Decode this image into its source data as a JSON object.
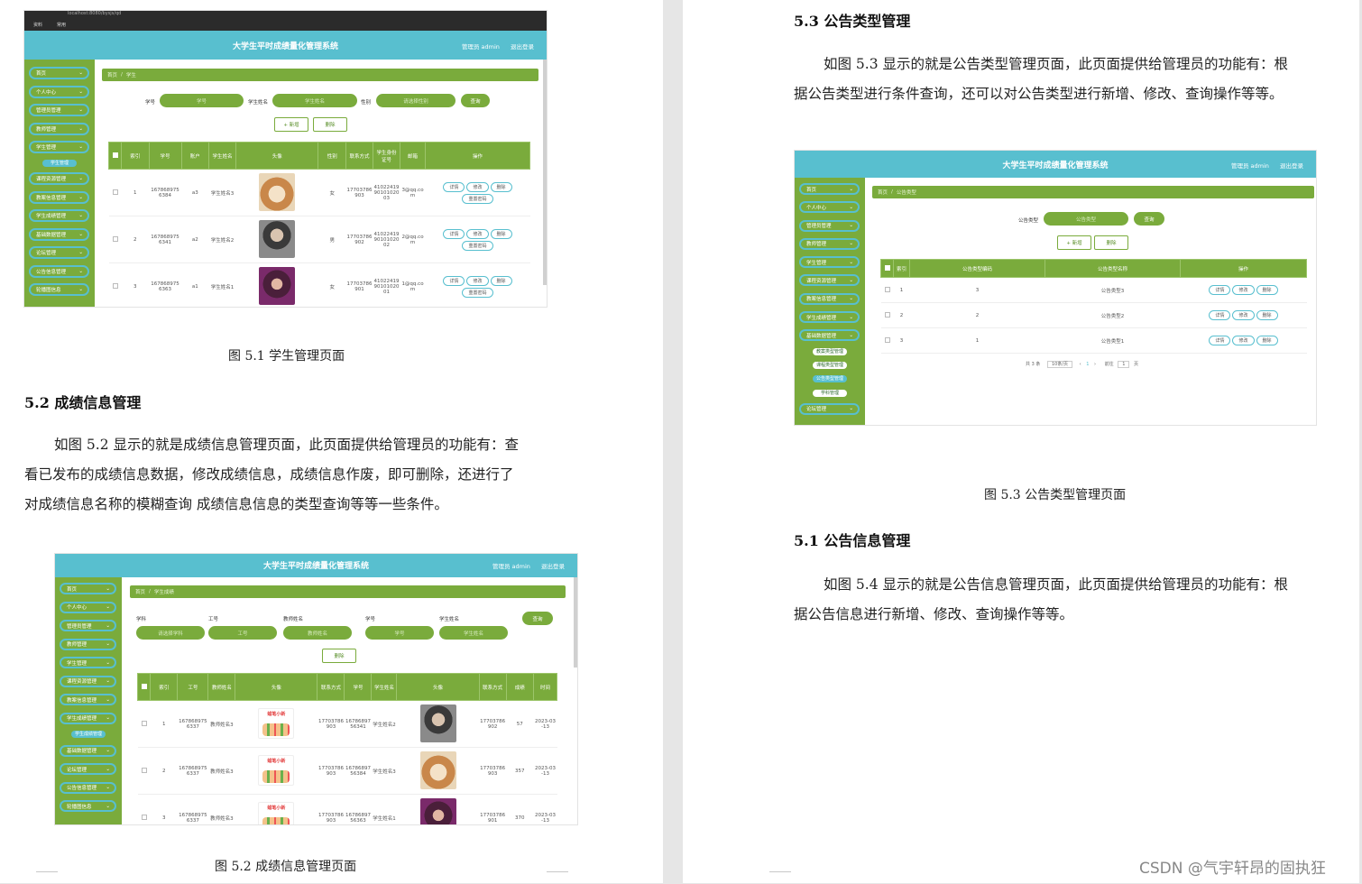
{
  "left_page": {
    "shot1": {
      "browser_text": "localhost:8080/bysjs/qd",
      "bookmarks": [
        "资料",
        "常用"
      ],
      "app_title": "大学生平时成绩量化管理系统",
      "user_text": "管理员 admin",
      "logout_text": "退出登录",
      "sidebar": [
        "首页",
        "个人中心",
        "管理员管理",
        "教师管理",
        "学生管理",
        "课程资源管理",
        "教案信息管理",
        "学生成绩管理",
        "基础数据管理",
        "论坛管理",
        "公告信息管理",
        "轮播图信息"
      ],
      "sidebar_sub": [
        "学生管理"
      ],
      "breadcrumb": [
        "首页",
        "学生"
      ],
      "filters": [
        {
          "label": "学号",
          "placeholder": "学号"
        },
        {
          "label": "学生姓名",
          "placeholder": "学生姓名"
        },
        {
          "label": "性别",
          "placeholder": "请选择性别"
        }
      ],
      "query_button": "查询",
      "add_button": "+ 新增",
      "delete_button": "删除",
      "columns": [
        "索引",
        "学号",
        "账户",
        "学生姓名",
        "头像",
        "性别",
        "联系方式",
        "学生身份证号",
        "邮箱",
        "操作"
      ],
      "rows": [
        {
          "index": "1",
          "id": "1678689756384",
          "account": "a3",
          "name": "学生姓名3",
          "gender": "女",
          "phone": "17703786903",
          "idcard": "410224199010102003",
          "email": "3@qq.com",
          "avatar": "dog"
        },
        {
          "index": "2",
          "id": "1678689756341",
          "account": "a2",
          "name": "学生姓名2",
          "gender": "男",
          "phone": "17703786902",
          "idcard": "410224199010102002",
          "email": "2@qq.com",
          "avatar": "man"
        },
        {
          "index": "3",
          "id": "1678689756363",
          "account": "a1",
          "name": "学生姓名1",
          "gender": "女",
          "phone": "17703786901",
          "idcard": "410224199010102001",
          "email": "1@qq.com",
          "avatar": "purple"
        }
      ],
      "row_actions": [
        "详情",
        "修改",
        "删除",
        "重置密码"
      ]
    },
    "caption1": "图 5.1  学生管理页面",
    "heading2": "5.2  成绩信息管理",
    "para2": [
      "如图 5.2 显示的就是成绩信息管理页面，此页面提供给管理员的功能有：查",
      "看已发布的成绩信息数据，修改成绩信息，成绩信息作废，即可删除，还进行了",
      "对成绩信息名称的模糊查询  成绩信息信息的类型查询等等一些条件。"
    ],
    "shot2": {
      "app_title": "大学生平时成绩量化管理系统",
      "user_text": "管理员 admin",
      "logout_text": "退出登录",
      "sidebar": [
        "首页",
        "个人中心",
        "管理员管理",
        "教师管理",
        "学生管理",
        "课程资源管理",
        "教案信息管理",
        "学生成绩管理",
        "基础数据管理",
        "论坛管理",
        "公告信息管理",
        "轮播图信息"
      ],
      "sidebar_sub": [
        "学生成绩管理"
      ],
      "breadcrumb": [
        "首页",
        "学生成绩"
      ],
      "filters": [
        {
          "label": "学科",
          "placeholder": "请选择学科"
        },
        {
          "label": "工号",
          "placeholder": "工号"
        },
        {
          "label": "教师姓名",
          "placeholder": "教师姓名"
        },
        {
          "label": "学号",
          "placeholder": "学号"
        },
        {
          "label": "学生姓名",
          "placeholder": "学生姓名"
        }
      ],
      "query_button": "查询",
      "delete_button": "删除",
      "columns": [
        "索引",
        "工号",
        "教师姓名",
        "头像",
        "联系方式",
        "学号",
        "学生姓名",
        "头像",
        "联系方式",
        "成绩",
        "时间"
      ],
      "rows": [
        {
          "index": "1",
          "job": "1678689756337",
          "teacher": "教师姓名3",
          "tphone": "17703786903",
          "sid": "1678689756341",
          "sname": "学生姓名2",
          "sphone": "17703786902",
          "score": "57",
          "time": "2023-03-13",
          "savatar": "man"
        },
        {
          "index": "2",
          "job": "1678689756337",
          "teacher": "教师姓名3",
          "tphone": "17703786903",
          "sid": "1678689756384",
          "sname": "学生姓名3",
          "sphone": "17703786903",
          "score": "357",
          "time": "2023-03-13",
          "savatar": "dog"
        },
        {
          "index": "3",
          "job": "1678689756337",
          "teacher": "教师姓名3",
          "tphone": "17703786903",
          "sid": "1678689756363",
          "sname": "学生姓名1",
          "sphone": "17703786901",
          "score": "370",
          "time": "2023-03-13",
          "savatar": "purple"
        }
      ],
      "cartoon_text": "蜡笔小新"
    },
    "caption2": "图 5.2  成绩信息管理页面"
  },
  "right_page": {
    "heading3": "5.3 公告类型管理",
    "para3": [
      "如图 5.3 显示的就是公告类型管理页面，此页面提供给管理员的功能有：根",
      "据公告类型进行条件查询，还可以对公告类型进行新增、修改、查询操作等等。"
    ],
    "shot3": {
      "app_title": "大学生平时成绩量化管理系统",
      "user_text": "管理员 admin",
      "logout_text": "退出登录",
      "sidebar": [
        "首页",
        "个人中心",
        "管理员管理",
        "教师管理",
        "学生管理",
        "课程资源管理",
        "教案信息管理",
        "学生成绩管理",
        "基础数据管理",
        "论坛管理"
      ],
      "sidebar_sub": [
        "教案类型管理",
        "课程类型管理",
        "公告类型管理",
        "学科管理"
      ],
      "breadcrumb": [
        "首页",
        "公告类型"
      ],
      "filter_label": "公告类型",
      "filter_placeholder": "公告类型",
      "query_button": "查询",
      "add_button": "+ 新增",
      "delete_button": "删除",
      "columns": [
        "索引",
        "公告类型编码",
        "公告类型名称",
        "操作"
      ],
      "rows": [
        {
          "index": "1",
          "code": "3",
          "name": "公告类型3"
        },
        {
          "index": "2",
          "code": "2",
          "name": "公告类型2"
        },
        {
          "index": "3",
          "code": "1",
          "name": "公告类型1"
        }
      ],
      "row_actions": [
        "详情",
        "修改",
        "删除"
      ],
      "pager": {
        "total": "共 3 条",
        "size": "10条/页",
        "page": "1",
        "goto": "前往",
        "goto_value": "1",
        "unit": "页"
      }
    },
    "caption3": "图 5.3  公告类型管理页面",
    "heading4": "5.1 公告信息管理",
    "para4": [
      "如图 5.4 显示的就是公告信息管理页面，此页面提供给管理员的功能有：根",
      "据公告信息进行新增、修改、查询操作等等。"
    ],
    "watermark": "CSDN @气宇轩昂的固执狂"
  }
}
